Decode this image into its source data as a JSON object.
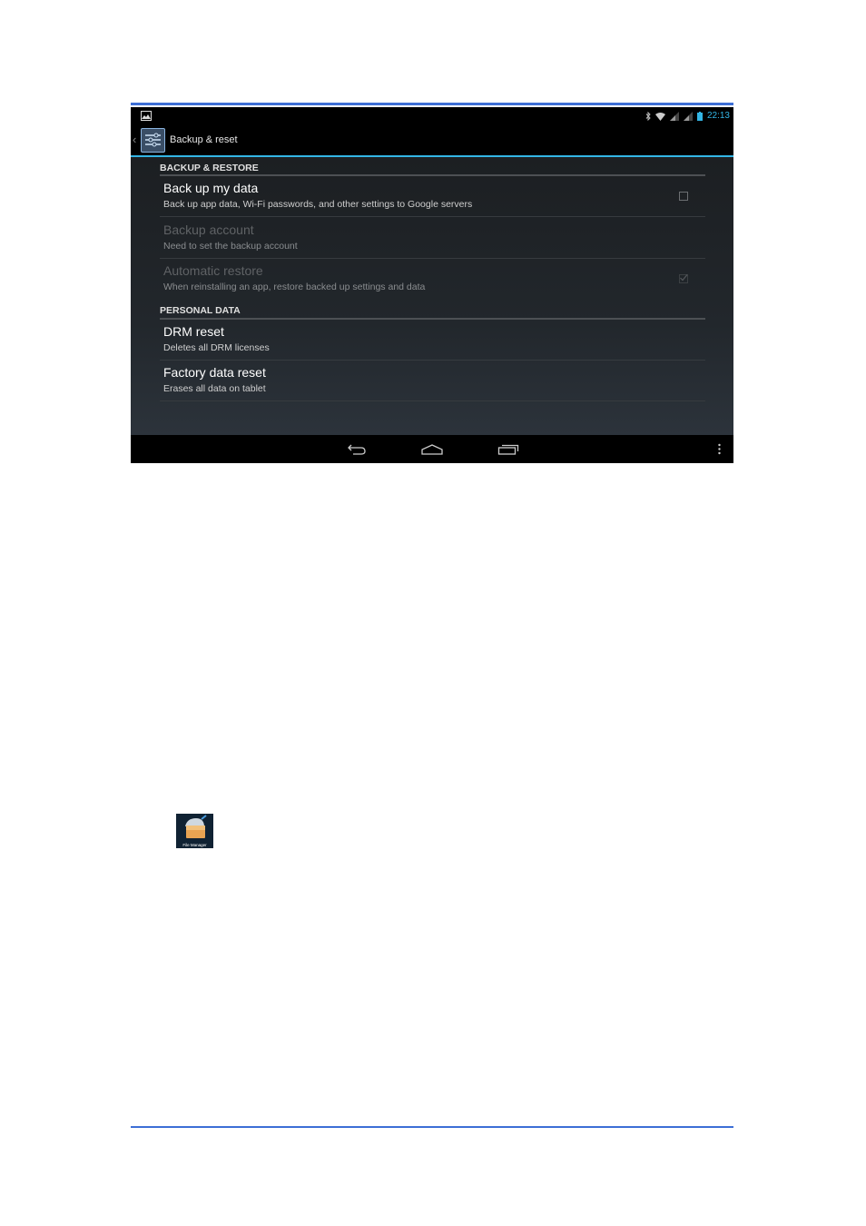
{
  "status_bar": {
    "time": "22:13"
  },
  "action_bar": {
    "title": "Backup & reset"
  },
  "sections": [
    {
      "header": "BACKUP & RESTORE",
      "items": [
        {
          "title": "Back up my data",
          "summary": "Back up app data, Wi-Fi passwords, and other settings to Google servers",
          "enabled": true,
          "checkbox": "unchecked"
        },
        {
          "title": "Backup account",
          "summary": "Need to set the backup account",
          "enabled": false
        },
        {
          "title": "Automatic restore",
          "summary": "When reinstalling an app, restore backed up settings and data",
          "enabled": false,
          "checkbox": "checked"
        }
      ]
    },
    {
      "header": "PERSONAL DATA",
      "items": [
        {
          "title": "DRM reset",
          "summary": "Deletes all DRM licenses",
          "enabled": true
        },
        {
          "title": "Factory data reset",
          "summary": "Erases all data on tablet",
          "enabled": true
        }
      ]
    }
  ],
  "nav_bar": {
    "buttons": [
      "back-icon",
      "home-icon",
      "recent-apps-icon",
      "overflow-menu-icon"
    ]
  },
  "file_manager_icon": {
    "label": "File Manager"
  },
  "colors": {
    "accent": "#33b5e5",
    "page_rule": "#3d6fd6",
    "background": "#1c1f22"
  }
}
